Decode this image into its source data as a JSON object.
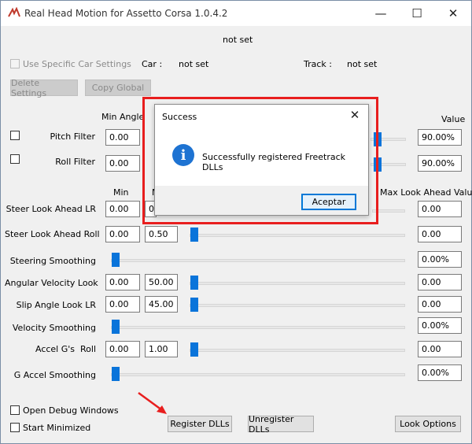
{
  "window": {
    "title": "Real Head Motion for Assetto Corsa 1.0.4.2",
    "minimize_glyph": "—",
    "maximize_glyph": "☐",
    "close_glyph": "✕"
  },
  "status_text": "not set",
  "car_settings": {
    "use_specific_label": "Use Specific Car Settings",
    "car_label": "Car :",
    "car_value": "not set",
    "track_label": "Track :",
    "track_value": "not set",
    "delete_label": "Delete Settings",
    "copy_label": "Copy Global"
  },
  "filters": {
    "min_angle_header": "Min Angle",
    "value_header": "Value",
    "rows": [
      {
        "label": "Pitch Filter",
        "min": "0.00",
        "value": "90.00%",
        "level": 0.75
      },
      {
        "label": "Roll Filter",
        "min": "0.00",
        "value": "90.00%",
        "level": 0.75
      }
    ]
  },
  "look_ahead": {
    "min_header": "Min",
    "max_header_prefix": "M",
    "max_look_ahead_header": "Max Look Ahead Value",
    "rows": [
      {
        "label": "Steer Look Ahead LR",
        "min": "0.00",
        "max": "0.",
        "value": "0.00",
        "level": 0.0
      },
      {
        "label": "Steer Look Ahead Roll",
        "min": "0.00",
        "max": "0.50",
        "value": "0.00",
        "level": 0.0
      },
      {
        "label": "Steering Smoothing",
        "value": "0.00%",
        "level": 0.0
      },
      {
        "label": "Angular Velocity Look",
        "min": "0.00",
        "max": "50.00",
        "value": "0.00",
        "level": 0.0
      },
      {
        "label": "Slip Angle Look LR",
        "min": "0.00",
        "max": "45.00",
        "value": "0.00",
        "level": 0.0
      },
      {
        "label": "Velocity Smoothing",
        "value": "0.00%",
        "level": 0.0
      },
      {
        "label": "Accel G's  Roll",
        "min": "0.00",
        "max": "1.00",
        "value": "0.00",
        "level": 0.0
      },
      {
        "label": "G Accel Smoothing",
        "value": "0.00%",
        "level": 0.0
      }
    ]
  },
  "bottom": {
    "open_debug_label": "Open Debug Windows",
    "start_minimized_label": "Start Minimized",
    "register_label": "Register DLLs",
    "unregister_label": "Unregister DLLs",
    "look_options_label": "Look Options"
  },
  "dialog": {
    "title": "Success",
    "close_glyph": "✕",
    "icon_glyph": "i",
    "message": "Successfully registered Freetrack DLLs",
    "ok_label": "Aceptar"
  },
  "colors": {
    "accent": "#0a74da",
    "highlight": "#e81e1e",
    "info_icon": "#1e73d2"
  }
}
